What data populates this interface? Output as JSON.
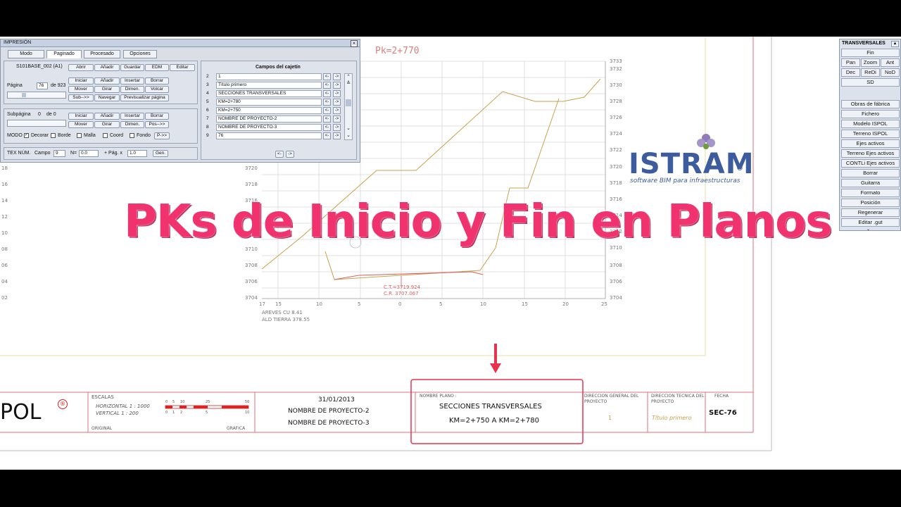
{
  "overlay_title": "PKs  de Inicio y Fin en Planos",
  "brand": {
    "name": "ISTRAM",
    "reg": "®",
    "tagline": "software BIM para infraestructuras"
  },
  "drawing": {
    "pk_label": "Pk=2+770",
    "right_axis": [
      "3733",
      "3732",
      "3730",
      "3728",
      "3726",
      "3724",
      "3722",
      "3720",
      "3718",
      "3716",
      "3714",
      "3712",
      "3710",
      "3708",
      "3706",
      "3704"
    ],
    "left_axis": [
      "3720",
      "3718",
      "3716",
      "3714",
      "3712",
      "3710",
      "3708",
      "3706",
      "3704"
    ],
    "far_left_axis": [
      "18",
      "16",
      "14",
      "12",
      "10",
      "08",
      "06",
      "04",
      "02"
    ],
    "x_axis": [
      "17",
      "15",
      "10",
      "5",
      "0",
      "5",
      "10",
      "15",
      "20",
      "25"
    ],
    "ct": "C.T.=3719.924",
    "cr": "C.R. 3707.067",
    "note1": "AREVES CU 8.41",
    "note2": "ALD TIERRA 378.55"
  },
  "title_block": {
    "logo_partial": "POL",
    "reg": "®",
    "escalas_label": "ESCALAS",
    "horizontal": "HORIZONTAL 1 : 1000",
    "vertical": "VERTICAL 1 : 200",
    "original": "ORIGINAL",
    "grafica": "GRAFICA",
    "scale_top": [
      "0",
      "5",
      "10",
      "25",
      "50"
    ],
    "scale_bottom": [
      "0",
      "1",
      "2",
      "5",
      "10"
    ],
    "date": "31/01/2013",
    "project2": "NOMBRE DE PROYECTO-2",
    "project3": "NOMBRE DE PROYECTO-3",
    "nombre_plano_label": "NOMBRE PLANO :",
    "plano_line1": "SECCIONES TRANSVERSALES",
    "plano_line2": "KM=2+750  A KM=2+780",
    "dir_general": "DIRECCION GENERAL DEL PROYECTO",
    "dir_general_val": "1",
    "dir_tecnica": "DIRECCION TECNICA DEL PROYECTO",
    "dir_tecnica_val": "Título primero",
    "fecha": "FECHA",
    "sheet": "SEC-76"
  },
  "dialog": {
    "title": "IMPRESIÓN",
    "tabs": [
      "Modo",
      "Paginado",
      "Procesado",
      "Opciones"
    ],
    "file": "S101BASE_002 (A1)",
    "file_buttons": [
      "Abrir",
      "Añadir",
      "Guardar",
      "EDM",
      "Editar"
    ],
    "pagina_label": "Página",
    "pagina_val": "76",
    "pagina_of": "de 923",
    "btn_row1": [
      "Iniciar",
      "Añadir",
      "Insertar",
      "Borrar"
    ],
    "btn_row2": [
      "Mover",
      "Girar",
      "Dimen.",
      "Volcar"
    ],
    "btn_row3": [
      "Sub-->>",
      "Navegar",
      "Previsualizar página"
    ],
    "subpagina_label": "Subpágina",
    "subpagina_val": "0",
    "subpagina_of": "de 0",
    "sub_row1": [
      "Iniciar",
      "Añadir",
      "Insertar",
      "Borrar"
    ],
    "sub_row2": [
      "Mover",
      "Girar",
      "Dimen.",
      "Pos-->>"
    ],
    "modo_label": "MODO",
    "modo_checks": [
      "Decorar",
      "Borde",
      "Malla",
      "Coord",
      "Fondo"
    ],
    "modo_btn": "P->>",
    "tex_label": "TEX NÚM.",
    "campo_label": "Campo",
    "campo_val": "9",
    "n_label": "N=",
    "n_val": "0.0",
    "pag_label": "+ Pág. x",
    "pag_val": "1.0",
    "gen_btn": "Gen.",
    "campos_title": "Campos del cajetín",
    "campos": [
      {
        "n": "2",
        "v": "1"
      },
      {
        "n": "3",
        "v": "Título primero"
      },
      {
        "n": "4",
        "v": "SECCIONES TRANSVERSALES"
      },
      {
        "n": "5",
        "v": "KM=2+780"
      },
      {
        "n": "6",
        "v": "KM=2+750"
      },
      {
        "n": "7",
        "v": "NOMBRE DE PROYECTO-2"
      },
      {
        "n": "8",
        "v": "NOMBRE DE PROYECTO-3"
      },
      {
        "n": "9",
        "v": "76"
      }
    ],
    "arrow_left": "<-",
    "arrow_right": "->"
  },
  "right_panel": {
    "title": "TRANSVERSALES",
    "fin": "Fin",
    "grid": [
      "Pan",
      "Zoom",
      "Ant",
      "Dec",
      "ReDi",
      "NoD"
    ],
    "sd": "SD",
    "items": [
      "Obras de fábrica",
      "Fichero",
      "Modelo ISPOL",
      "Terreno ISPOL",
      "Ejes activos",
      "Terreno Ejes activos",
      "CONTLi Ejes activos",
      "Borrar",
      "Guitarra",
      "Formato",
      "Posición",
      "Regenerar",
      "Editar .gut"
    ]
  },
  "colors": {
    "overlay": "#f0336e",
    "brand": "#3d5c9d",
    "frame": "#e0707a",
    "terrain": "#c9a24a",
    "design": "#d86060"
  }
}
